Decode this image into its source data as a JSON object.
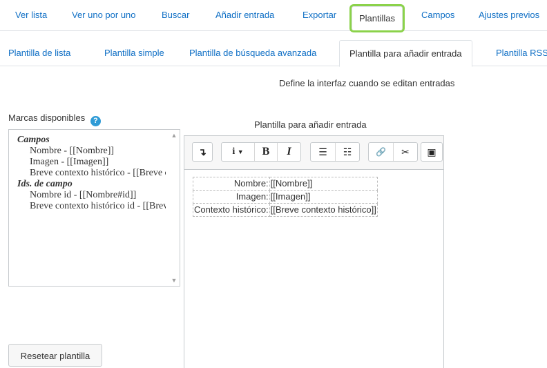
{
  "topnav": {
    "tabs": [
      {
        "label": "Ver lista"
      },
      {
        "label": "Ver uno por uno"
      },
      {
        "label": "Buscar"
      },
      {
        "label": "Añadir entrada"
      },
      {
        "label": "Exportar"
      },
      {
        "label": "Plantillas",
        "active": true
      },
      {
        "label": "Campos"
      },
      {
        "label": "Ajustes previos"
      }
    ]
  },
  "subnav": {
    "tabs": [
      {
        "label": "Plantilla de lista"
      },
      {
        "label": "Plantilla simple"
      },
      {
        "label": "Plantilla de búsqueda avanzada"
      },
      {
        "label": "Plantilla para añadir entrada",
        "active": true
      },
      {
        "label": "Plantilla RSS"
      }
    ]
  },
  "description": "Define la interfaz cuando se editan entradas",
  "marcas": {
    "label": "Marcas disponibles",
    "help_icon": "question-circle-icon",
    "groups": [
      {
        "title": "Campos",
        "items": [
          "Nombre - [[Nombre]]",
          "Imagen - [[Imagen]]",
          "Breve contexto histórico - [[Breve contexto histórico]]"
        ]
      },
      {
        "title": "Ids. de campo",
        "items": [
          "Nombre id - [[Nombre#id]]",
          "Breve contexto histórico id - [[Breve contexto histórico#id]]"
        ]
      }
    ]
  },
  "reset_button": "Resetear plantilla",
  "editor": {
    "label": "Plantilla para añadir entrada",
    "toolbar": {
      "collapse_icon": "↴",
      "info_icon": "i",
      "bold": "B",
      "italic": "I",
      "unordered_list_icon": "☰",
      "ordered_list_icon": "☷",
      "link_icon": "🔗",
      "unlink_icon": "✂",
      "image_icon": "▣"
    },
    "rows": [
      {
        "label": "Nombre:",
        "tag": "[[Nombre]]"
      },
      {
        "label": "Imagen:",
        "tag": "[[Imagen]]"
      },
      {
        "label": "Contexto histórico:",
        "tag": "[[Breve contexto histórico]]"
      }
    ]
  },
  "colors": {
    "link": "#0f6fc5",
    "active_highlight": "#8bd24a",
    "border": "#dee2e6"
  }
}
